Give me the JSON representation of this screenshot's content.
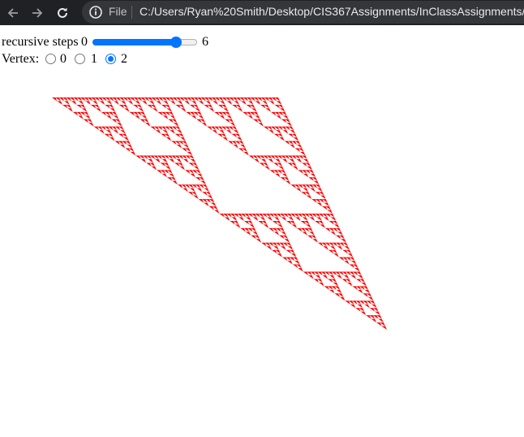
{
  "browser": {
    "file_label": "File",
    "url": "C:/Users/Ryan%20Smith/Desktop/CIS367Assignments/InClassAssignments/ry"
  },
  "controls": {
    "steps_label": "recursive steps",
    "steps_min": "0",
    "steps_max": "6",
    "steps_value": 5,
    "vertex_label": "Vertex:",
    "vertex_options": [
      "0",
      "1",
      "2"
    ],
    "vertex_selected": "2"
  },
  "fractal": {
    "color": "#ff0000",
    "depth": 6
  }
}
